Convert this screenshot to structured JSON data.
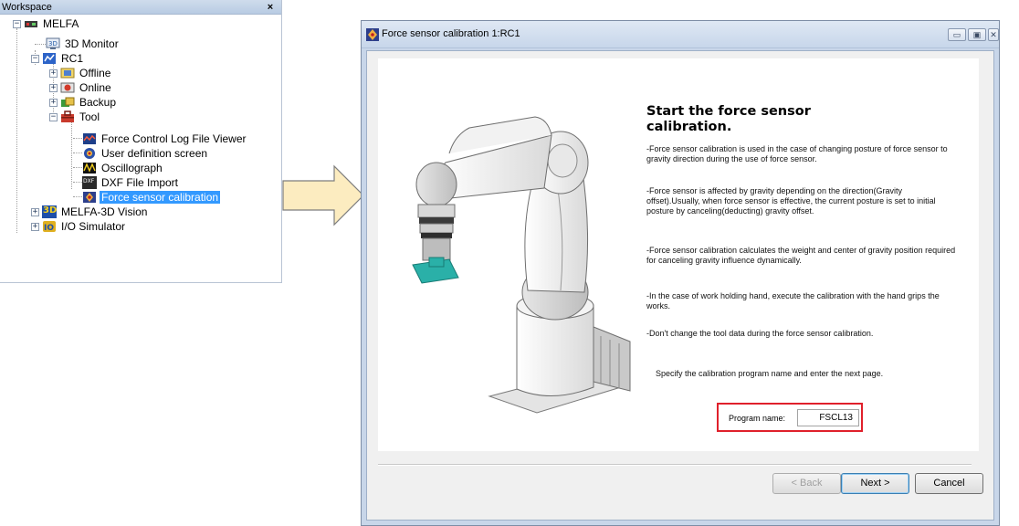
{
  "workspace": {
    "title": "Workspace",
    "close": "×",
    "tree": [
      {
        "label": "MELFA",
        "icon": "robot-cell-icon"
      },
      {
        "label": "3D Monitor",
        "icon": "3d-monitor-icon"
      },
      {
        "label": "RC1",
        "icon": "controller-icon"
      },
      {
        "label": "Offline",
        "icon": "offline-icon"
      },
      {
        "label": "Online",
        "icon": "online-icon"
      },
      {
        "label": "Backup",
        "icon": "backup-icon"
      },
      {
        "label": "Tool",
        "icon": "toolbox-icon"
      },
      {
        "label": "Force Control Log File Viewer",
        "icon": "log-viewer-icon"
      },
      {
        "label": "User definition screen",
        "icon": "user-definition-icon"
      },
      {
        "label": "Oscillograph",
        "icon": "oscillograph-icon"
      },
      {
        "label": "DXF File Import",
        "icon": "dxf-icon"
      },
      {
        "label": "Force sensor calibration",
        "icon": "force-sensor-icon",
        "selected": true
      },
      {
        "label": "MELFA-3D Vision",
        "icon": "3d-vision-icon"
      },
      {
        "label": "I/O Simulator",
        "icon": "io-simulator-icon"
      }
    ],
    "dxf_badge": "DXF",
    "vision_badge": "3D"
  },
  "dialog": {
    "title": "Force sensor calibration 1:RC1",
    "heading": "Start the force sensor calibration.",
    "paragraphs": [
      "-Force sensor calibration is used in the case of changing posture of force sensor to gravity direction during the use of force sensor.",
      "-Force sensor is affected by gravity depending on the direction(Gravity offset).Usually, when force sensor is effective, the current posture is set to initial posture by canceling(deducting) gravity offset.",
      "-Force sensor calibration calculates the weight and center of gravity position required for canceling gravity influence dynamically.",
      "-In the case of work holding hand, execute the calibration with the hand grips the works.",
      "-Don't change the tool data during the force sensor calibration."
    ],
    "instruction": "Specify the calibration program name and enter the next page.",
    "program_label": "Program name:",
    "program_value": "FSCL13",
    "buttons": {
      "back": "< Back",
      "next": "Next >",
      "cancel": "Cancel"
    }
  },
  "colors": {
    "selection": "#3399ff",
    "highlight_box": "#e0202b",
    "arrow_fill": "#fcecc0",
    "tool_tip": "#2ab0a8"
  }
}
